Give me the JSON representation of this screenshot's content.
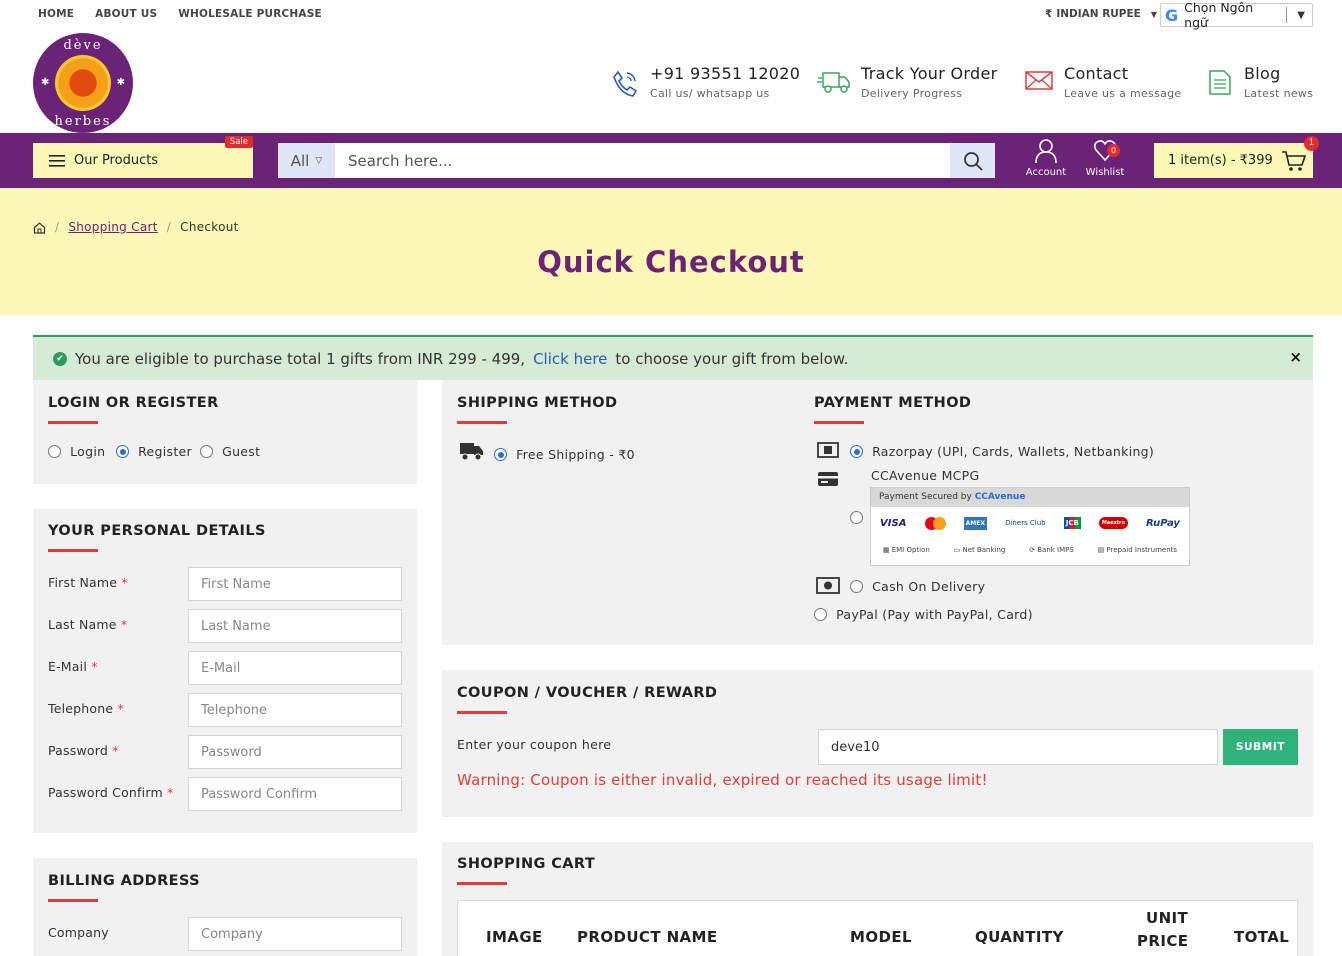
{
  "topnav": {
    "items": [
      "HOME",
      "ABOUT US",
      "WHOLESALE PURCHASE"
    ]
  },
  "currency": {
    "symbol": "₹",
    "label": "INDIAN RUPEE"
  },
  "translate": {
    "label": "Chọn Ngôn ngữ"
  },
  "logo": {
    "top_text": "dève",
    "bottom_text": "herbes"
  },
  "header": {
    "phone": {
      "title": "+91 93551 12020",
      "sub": "Call us/ whatsapp us"
    },
    "track": {
      "title": "Track Your Order",
      "sub": "Delivery Progress"
    },
    "contact": {
      "title": "Contact",
      "sub": "Leave us a message"
    },
    "blog": {
      "title": "Blog",
      "sub": "Latest news"
    }
  },
  "nav": {
    "products_label": "Our Products",
    "sale_badge": "Sale",
    "search_category": "All",
    "search_placeholder": "Search here...",
    "account_label": "Account",
    "wishlist_label": "Wishlist",
    "wishlist_count": "0",
    "cart_label": "1 item(s) - ₹399",
    "cart_count": "1"
  },
  "breadcrumb": {
    "cart": "Shopping Cart",
    "current": "Checkout"
  },
  "page_title": "Quick Checkout",
  "alert": {
    "text_before": "You are eligible to purchase total 1 gifts from INR 299 - 499,",
    "link": "Click here",
    "text_after": "to choose your gift from below.",
    "close": "×"
  },
  "login": {
    "title": "LOGIN OR REGISTER",
    "options": [
      "Login",
      "Register",
      "Guest"
    ],
    "selected": "Register"
  },
  "personal": {
    "title": "YOUR PERSONAL DETAILS",
    "fields": [
      {
        "label": "First Name",
        "placeholder": "First Name"
      },
      {
        "label": "Last Name",
        "placeholder": "Last Name"
      },
      {
        "label": "E-Mail",
        "placeholder": "E-Mail"
      },
      {
        "label": "Telephone",
        "placeholder": "Telephone"
      },
      {
        "label": "Password",
        "placeholder": "Password"
      },
      {
        "label": "Password Confirm",
        "placeholder": "Password Confirm"
      }
    ]
  },
  "billing": {
    "title": "BILLING ADDRESS",
    "company_label": "Company",
    "company_placeholder": "Company"
  },
  "shipping": {
    "title": "SHIPPING METHOD",
    "option": "Free Shipping - ₹0"
  },
  "payment": {
    "title": "PAYMENT METHOD",
    "razorpay": "Razorpay (UPI, Cards, Wallets, Netbanking)",
    "ccavenue": "CCAvenue MCPG",
    "cc_secured": "Payment Secured by",
    "cc_brand": "CCAvenue",
    "cc_cards": [
      "VISA",
      "MC",
      "AMEX",
      "Diners Club",
      "JCB",
      "Maestro",
      "RuPay"
    ],
    "cc_options": [
      "EMI Option",
      "Net Banking",
      "Bank IMPS",
      "Prepaid Instruments"
    ],
    "cod": "Cash On Delivery",
    "paypal": "PayPal (Pay with PayPal, Card)"
  },
  "coupon": {
    "title": "COUPON / VOUCHER / REWARD",
    "label": "Enter your coupon here",
    "value": "deve10",
    "submit": "SUBMIT",
    "warning": "Warning: Coupon is either invalid, expired or reached its usage limit!"
  },
  "cart": {
    "title": "SHOPPING CART",
    "columns": [
      "IMAGE",
      "PRODUCT NAME",
      "MODEL",
      "QUANTITY",
      "UNIT",
      "PRICE",
      "TOTAL"
    ]
  },
  "colors": {
    "brand": "#6b2377",
    "yellow": "#fdf7b7",
    "accent_red": "#e03c3c",
    "green": "#2fb37b"
  }
}
